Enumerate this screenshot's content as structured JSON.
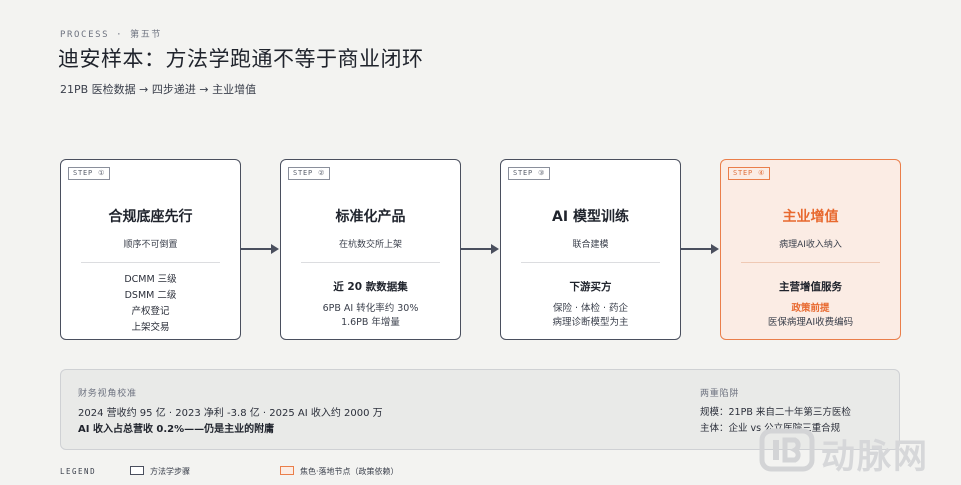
{
  "header": {
    "kicker": "PROCESS · 第五节",
    "title": "迪安样本：方法学跑通不等于商业闭环",
    "subtitle": "21PB 医检数据 → 四步递进 → 主业增值"
  },
  "steps": [
    {
      "tag": "STEP ①",
      "title": "合规底座先行",
      "subtitle": "顺序不可倒置",
      "items": [
        "DCMM 三级",
        "DSMM 二级",
        "产权登记",
        "上架交易"
      ]
    },
    {
      "tag": "STEP ②",
      "title": "标准化产品",
      "subtitle": "在杭数交所上架",
      "bold": "近 20 款数据集",
      "lines": [
        "6PB AI 转化率约 30%",
        "1.6PB 年增量"
      ]
    },
    {
      "tag": "STEP ③",
      "title": "AI 模型训练",
      "subtitle": "联合建模",
      "bold": "下游买方",
      "lines": [
        "保险 · 体检 · 药企",
        "病理诊断模型为主"
      ]
    },
    {
      "tag": "STEP ④",
      "title": "主业增值",
      "subtitle": "病理AI收入纳入",
      "bold": "主营增值服务",
      "policy": "政策前提",
      "lines": [
        "医保病理AI收费编码"
      ]
    }
  ],
  "finance": {
    "label": "财务视角校准",
    "line1": "2024 营收约 95 亿 · 2023 净利 -3.8 亿 · 2025 AI 收入约 2000 万",
    "line2": "AI 收入占总营收 0.2%——仍是主业的附庸"
  },
  "traps": {
    "label": "两重陷阱",
    "line1": "规模：21PB 来自二十年第三方医检",
    "line2": "主体：企业 vs 公立医院三重合规"
  },
  "legend": {
    "title": "LEGEND",
    "item1": "方法学步骤",
    "item2": "焦色·落地节点（政策依赖）"
  },
  "watermark": {
    "text": "动脉网"
  },
  "colors": {
    "accent": "#e8692f",
    "accent_bg": "#fbece4",
    "border": "#4a4f5e"
  }
}
